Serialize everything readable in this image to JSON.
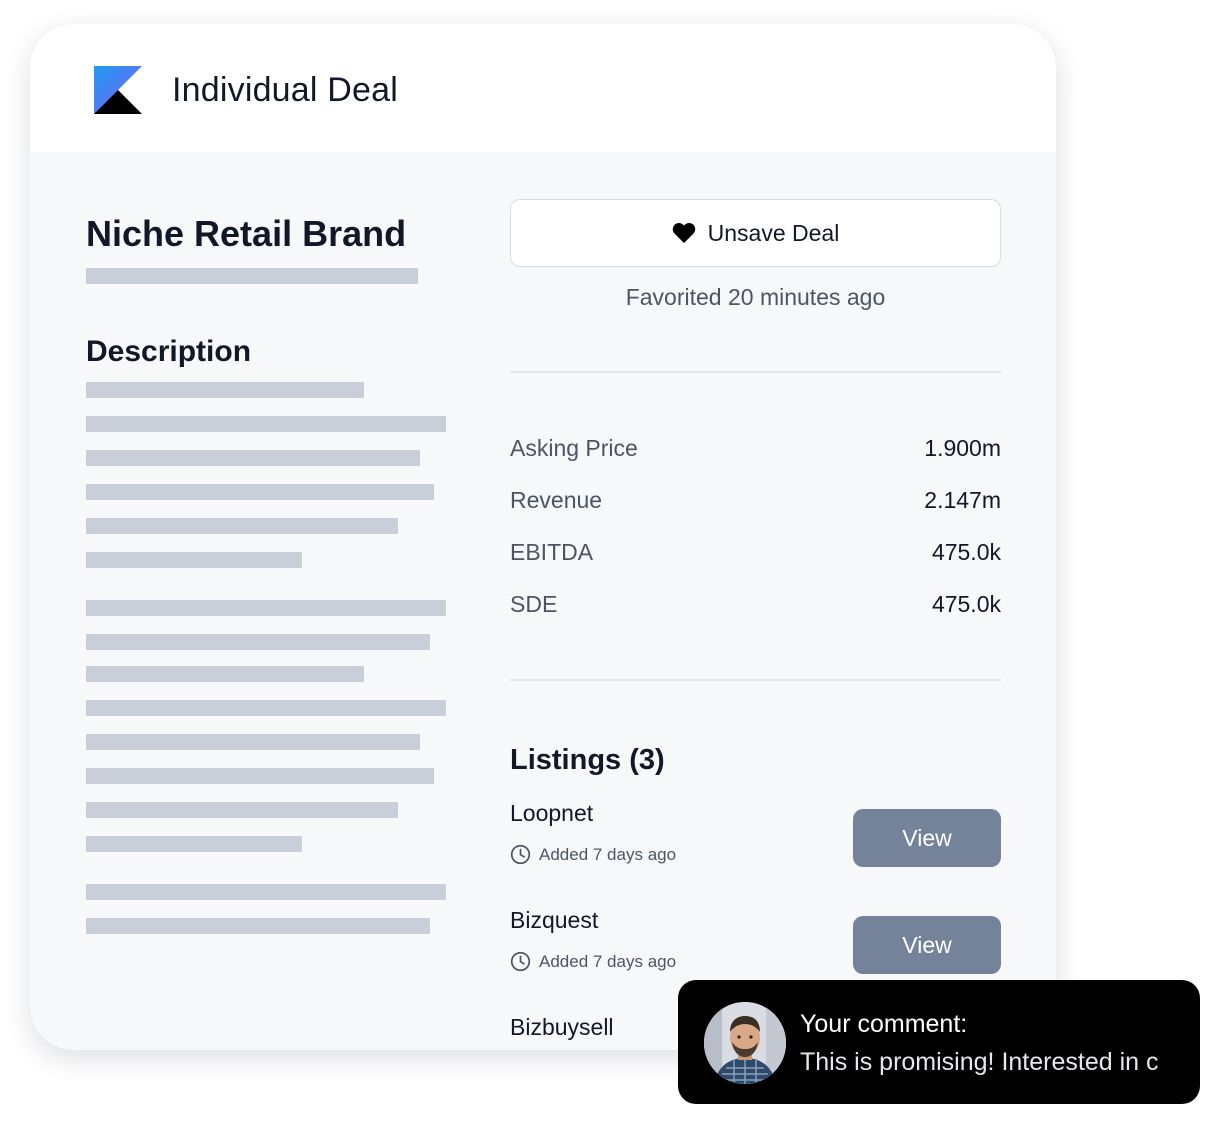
{
  "header": {
    "app_title": "Individual Deal"
  },
  "deal": {
    "title": "Niche Retail Brand"
  },
  "description": {
    "heading": "Description"
  },
  "actions": {
    "unsave_label": "Unsave Deal",
    "favorited_text": "Favorited 20 minutes ago"
  },
  "metrics": [
    {
      "label": "Asking Price",
      "value": "1.900m"
    },
    {
      "label": "Revenue",
      "value": "2.147m"
    },
    {
      "label": "EBITDA",
      "value": "475.0k"
    },
    {
      "label": "SDE",
      "value": "475.0k"
    }
  ],
  "listings": {
    "title": "Listings (3)",
    "items": [
      {
        "name": "Loopnet",
        "added": "Added 7 days ago",
        "button": "View"
      },
      {
        "name": "Bizquest",
        "added": "Added 7 days ago",
        "button": "View"
      },
      {
        "name": "Bizbuysell"
      }
    ]
  },
  "comment": {
    "label": "Your comment:",
    "text": "This is promising! Interested in c"
  },
  "icons": {
    "logo": "k-logo-icon",
    "heart": "heart-icon",
    "clock": "clock-icon"
  },
  "colors": {
    "logo_blue": "#3b82f6",
    "logo_black": "#000000",
    "view_button": "#74829a",
    "placeholder_bar": "#c9cfd9",
    "toast_background": "#000000"
  }
}
